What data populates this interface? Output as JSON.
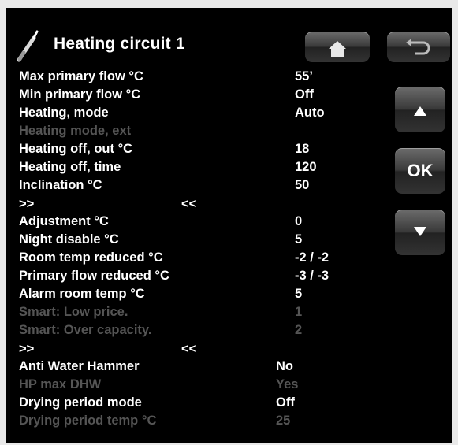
{
  "header": {
    "title": "Heating circuit 1"
  },
  "buttons": {
    "ok_label": "OK"
  },
  "rows": [
    {
      "label": "Max primary flow °C",
      "value": "55’"
    },
    {
      "label": "Min primary flow °C",
      "value": "Off"
    },
    {
      "label": "Heating, mode",
      "value": "Auto"
    },
    {
      "label": "Heating mode, ext",
      "value": ""
    },
    {
      "label": "Heating off, out °C",
      "value": "18"
    },
    {
      "label": "Heating off, time",
      "value": "120"
    },
    {
      "label": "Inclination °C",
      "value": "50"
    },
    {
      "label": ">>",
      "value": "",
      "mark": "<<"
    },
    {
      "label": "Adjustment °C",
      "value": "0"
    },
    {
      "label": "Night disable °C",
      "value": "5"
    },
    {
      "label": "Room temp reduced °C",
      "value": "-2 / -2"
    },
    {
      "label": "Primary flow reduced °C",
      "value": "-3 / -3"
    },
    {
      "label": "Alarm room temp °C",
      "value": "5"
    },
    {
      "label": "Smart: Low price.",
      "value": "1"
    },
    {
      "label": "Smart: Over capacity.",
      "value": "2"
    },
    {
      "label": ">>",
      "value": "",
      "mark": "<<"
    },
    {
      "label": "Anti Water Hammer",
      "value": "No"
    },
    {
      "label": "HP max DHW",
      "value": "Yes"
    },
    {
      "label": "Drying period mode",
      "value": "Off"
    },
    {
      "label": "Drying period temp °C",
      "value": "25"
    }
  ]
}
